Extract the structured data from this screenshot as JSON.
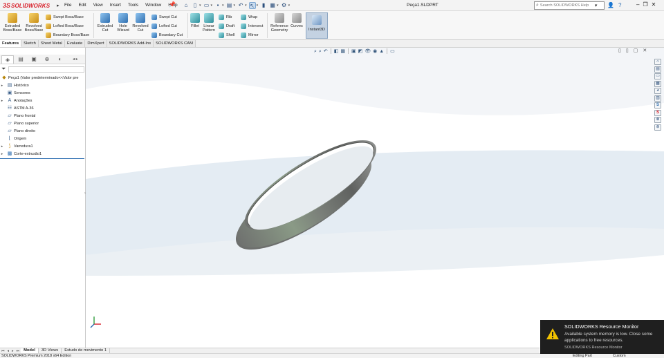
{
  "app": {
    "brand": "SOLIDWORKS",
    "menu": [
      "File",
      "Edit",
      "View",
      "Insert",
      "Tools",
      "Window",
      "Help"
    ],
    "document_title": "Peça1.SLDPRT",
    "search_placeholder": "Search SOLIDWORKS Help",
    "help_label": "?"
  },
  "ribbon": {
    "extruded_boss": "Extruded Boss/Base",
    "revolved_boss": "Revolved Boss/Base",
    "swept_boss": "Swept Boss/Base",
    "lofted_boss": "Lofted Boss/Base",
    "boundary_boss": "Boundary Boss/Base",
    "extruded_cut": "Extruded Cut",
    "hole_wizard": "Hole Wizard",
    "revolved_cut": "Revolved Cut",
    "swept_cut": "Swept Cut",
    "lofted_cut": "Lofted Cut",
    "boundary_cut": "Boundary Cut",
    "fillet": "Fillet",
    "linear_pattern": "Linear Pattern",
    "rib": "Rib",
    "draft": "Draft",
    "shell": "Shell",
    "wrap": "Wrap",
    "intersect": "Intersect",
    "mirror": "Mirror",
    "reference_geometry": "Reference Geometry",
    "curves": "Curves",
    "instant3d": "Instant3D"
  },
  "command_tabs": [
    "Features",
    "Sketch",
    "Sheet Metal",
    "Evaluate",
    "DimXpert",
    "SOLIDWORKS Add-Ins",
    "SOLIDWORKS CAM"
  ],
  "feature_tree": {
    "root": "Peça1  (Valor predeterminado<<Valor pre",
    "items": [
      {
        "label": "Histórico",
        "icon": "history-icon",
        "expandable": true
      },
      {
        "label": "Sensores",
        "icon": "sensor-icon",
        "expandable": false
      },
      {
        "label": "Anotações",
        "icon": "annotations-icon",
        "expandable": true
      },
      {
        "label": "ASTM A-36",
        "icon": "material-icon",
        "expandable": false
      },
      {
        "label": "Plano frontal",
        "icon": "plane-icon",
        "expandable": false
      },
      {
        "label": "Plano superior",
        "icon": "plane-icon",
        "expandable": false
      },
      {
        "label": "Plano direito",
        "icon": "plane-icon",
        "expandable": false
      },
      {
        "label": "Origem",
        "icon": "origin-icon",
        "expandable": false
      },
      {
        "label": "Varredura1",
        "icon": "sweep-feature-icon",
        "expandable": true
      },
      {
        "label": "Corte-extrusão1",
        "icon": "cut-extrude-feature-icon",
        "expandable": true
      }
    ]
  },
  "bottom_tabs": [
    "Model",
    "3D Views",
    "Estudo de movimento 1"
  ],
  "status": {
    "edition": "SOLIDWORKS Premium 2018 x64 Edition",
    "mode": "Editing Part",
    "units": "Custom"
  },
  "notification": {
    "title": "SOLIDWORKS Resource Monitor",
    "body": "Available system memory is low. Close some applications to free resources.",
    "source": "SOLIDWORKS Resource Monitor"
  },
  "colors": {
    "brand_red": "#d8202a",
    "selection_blue": "#2b6cb0",
    "toast_bg": "#1f1f1f",
    "warning_yellow": "#f2c200"
  }
}
